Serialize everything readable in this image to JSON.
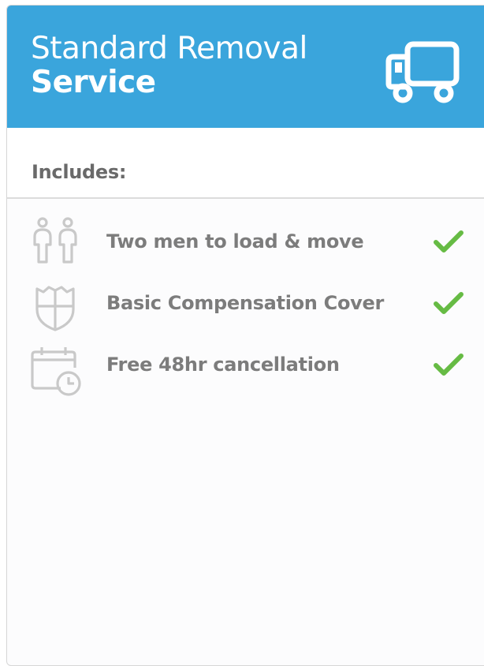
{
  "header": {
    "title_line1": "Standard Removal",
    "title_line2": "Service",
    "icon": "truck-icon",
    "background": "#3aa5dc"
  },
  "includes": {
    "label": "Includes:"
  },
  "features": [
    {
      "label": "Two men to load & move",
      "icon": "two-people-icon",
      "included": true
    },
    {
      "label": "Basic Compensation Cover",
      "icon": "shield-icon",
      "included": true
    },
    {
      "label": "Free 48hr cancellation",
      "icon": "calendar-clock-icon",
      "included": true
    }
  ],
  "colors": {
    "check": "#66bb44",
    "icon_gray": "#c9c9c9",
    "text_gray": "#7c7c7c"
  }
}
